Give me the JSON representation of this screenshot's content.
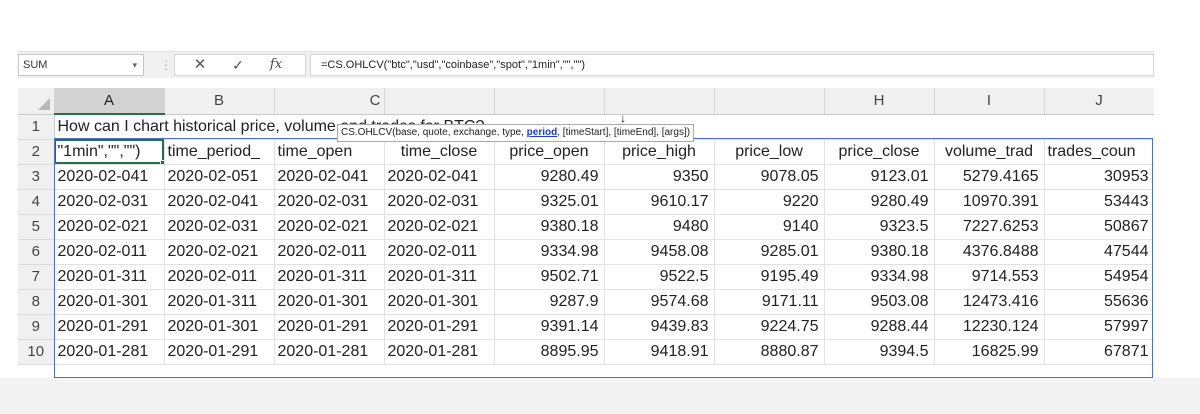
{
  "formula_bar": {
    "name_box": "SUM",
    "name_box_arrow": "▾",
    "separator": "⋮",
    "cancel_icon": "✕",
    "enter_icon": "✓",
    "fx_label": "fx",
    "formula": "=CS.OHLCV(\"btc\",\"usd\",\"coinbase\",\"spot\",\"1min\",\"\",\"\")"
  },
  "tooltip": {
    "prefix": "CS.OHLCV(base, quote, exchange, type, ",
    "current_arg": "period",
    "suffix": ", [timeStart], [timeEnd], [args])",
    "cursor_icon": "↓"
  },
  "columns": [
    "A",
    "B",
    "C",
    "H",
    "I",
    "J"
  ],
  "row_numbers": [
    "1",
    "2",
    "3",
    "4",
    "5",
    "6",
    "7",
    "8",
    "9",
    "10"
  ],
  "title": "How can I chart historical price, volume and trades for BTC?",
  "header_row": [
    "\"1min\",\"\",\"\")",
    "time_period_",
    "time_open",
    "time_close",
    "price_open",
    "price_high",
    "price_low",
    "price_close",
    "volume_trad",
    "trades_coun"
  ],
  "rows": [
    [
      "2020-02-041",
      "2020-02-051",
      "2020-02-041",
      "2020-02-041",
      "9280.49",
      "9350",
      "9078.05",
      "9123.01",
      "5279.4165",
      "30953"
    ],
    [
      "2020-02-031",
      "2020-02-041",
      "2020-02-031",
      "2020-02-031",
      "9325.01",
      "9610.17",
      "9220",
      "9280.49",
      "10970.391",
      "53443"
    ],
    [
      "2020-02-021",
      "2020-02-031",
      "2020-02-021",
      "2020-02-021",
      "9380.18",
      "9480",
      "9140",
      "9323.5",
      "7227.6253",
      "50867"
    ],
    [
      "2020-02-011",
      "2020-02-021",
      "2020-02-011",
      "2020-02-011",
      "9334.98",
      "9458.08",
      "9285.01",
      "9380.18",
      "4376.8488",
      "47544"
    ],
    [
      "2020-01-311",
      "2020-02-011",
      "2020-01-311",
      "2020-01-311",
      "9502.71",
      "9522.5",
      "9195.49",
      "9334.98",
      "9714.553",
      "54954"
    ],
    [
      "2020-01-301",
      "2020-01-311",
      "2020-01-301",
      "2020-01-301",
      "9287.9",
      "9574.68",
      "9171.11",
      "9503.08",
      "12473.416",
      "55636"
    ],
    [
      "2020-01-291",
      "2020-01-301",
      "2020-01-291",
      "2020-01-291",
      "9391.14",
      "9439.83",
      "9224.75",
      "9288.44",
      "12230.124",
      "57997"
    ],
    [
      "2020-01-281",
      "2020-01-291",
      "2020-01-281",
      "2020-01-281",
      "8895.95",
      "9418.91",
      "8880.87",
      "9394.5",
      "16825.99",
      "67871"
    ]
  ],
  "colors": {
    "selection_green": "#217346",
    "range_blue": "#4a74c8",
    "tooltip_active": "#1f3ccf"
  }
}
